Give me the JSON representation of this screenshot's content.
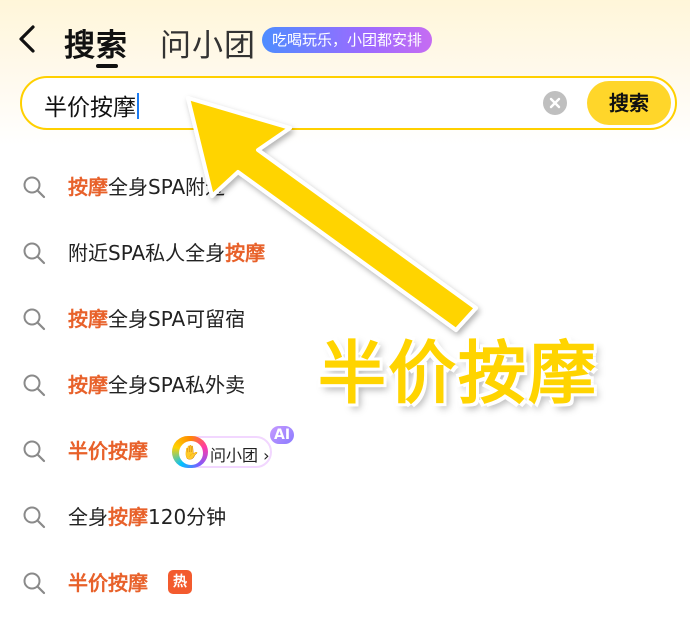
{
  "header": {
    "back_label": "",
    "tab_search": "搜索",
    "tab_ask": "问小团",
    "promo_badge": "吃喝玩乐，小团都安排"
  },
  "search": {
    "query": "半价按摩",
    "button_label": "搜索"
  },
  "suggestions": [
    {
      "highlight": "按摩",
      "rest": "全身SPA附近",
      "prefix": ""
    },
    {
      "prefix": "附近SPA私人全身",
      "highlight": "按摩",
      "rest": ""
    },
    {
      "highlight": "按摩",
      "rest": "全身SPA可留宿",
      "prefix": ""
    },
    {
      "highlight": "按摩",
      "rest": "全身SPA私外卖",
      "prefix": ""
    },
    {
      "highlight": "半价按摩",
      "rest": "",
      "prefix": "",
      "chip": "问小团",
      "chip_badge": "AI"
    },
    {
      "prefix": "全身",
      "highlight": "按摩",
      "rest": "120分钟"
    },
    {
      "highlight": "半价按摩",
      "rest": "",
      "prefix": "",
      "badge": "热"
    }
  ],
  "overlay": {
    "text": "半价按摩",
    "arrow_color": "#ffd400"
  },
  "colors": {
    "accent": "#ffd62a",
    "highlight": "#e8612a",
    "hot": "#f35b2e"
  }
}
